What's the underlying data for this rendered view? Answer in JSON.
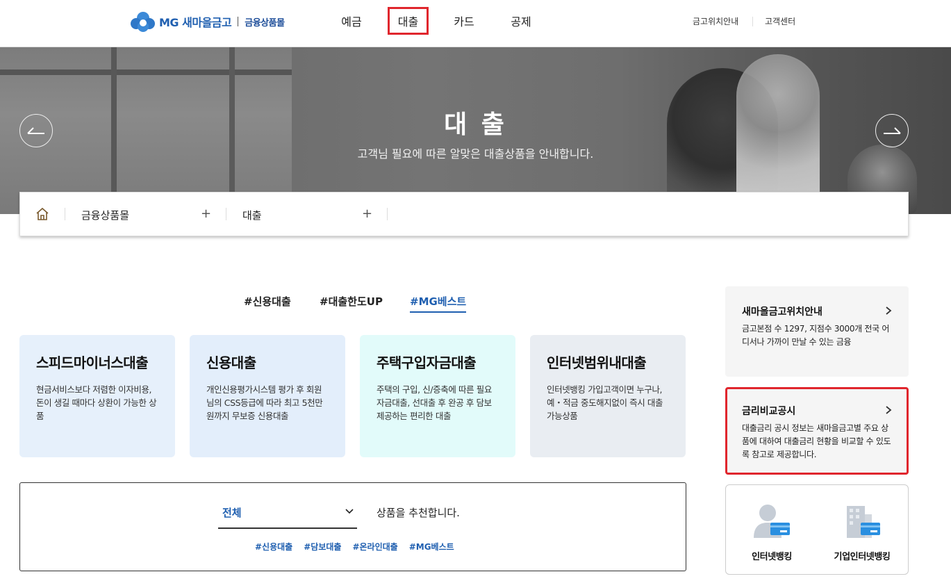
{
  "header": {
    "logo_brand": "MG 새마을금고",
    "logo_sub": "금융상품몰",
    "nav": [
      "예금",
      "대출",
      "카드",
      "공제"
    ],
    "util": [
      "금고위치안내",
      "고객센터"
    ]
  },
  "hero": {
    "title": "대 출",
    "subtitle": "고객님 필요에 따른 알맞은 대출상품을 안내합니다."
  },
  "breadcrumb": {
    "level1": "금융상품몰",
    "level2": "대출"
  },
  "hashtabs": [
    "#신용대출",
    "#대출한도UP",
    "#MG베스트"
  ],
  "cards": [
    {
      "title": "스피드마이너스대출",
      "desc": "현금서비스보다 저렴한 이자비용, 돈이 생길 때마다 상환이 가능한 상품",
      "color": "#e6f0fb"
    },
    {
      "title": "신용대출",
      "desc": "개인신용평가시스템 평가 후 회원님의 CSS등급에 따라 최고 5천만원까지 무보증 신용대출",
      "color": "#e3eefb"
    },
    {
      "title": "주택구입자금대출",
      "desc": "주택의 구입, 신/증축에 따른 필요자금대출, 선대출 후 완공 후 담보제공하는 편리한 대출",
      "color": "#e2fbfa"
    },
    {
      "title": "인터넷범위내대출",
      "desc": "인터넷뱅킹 가입고객이면 누구나, 예・적금 중도해지없이 즉시 대출가능상품",
      "color": "#e9edf2"
    }
  ],
  "recommend": {
    "select_value": "전체",
    "text": "상품을 추천합니다.",
    "tags": [
      "#신용대출",
      "#담보대출",
      "#온라인대출",
      "#MG베스트"
    ]
  },
  "side": {
    "location": {
      "title": "새마을금고위치안내",
      "desc": "금고본점 수 1297, 지점수 3000개 전국 어디서나 가까이 만날 수 있는 금융"
    },
    "rate": {
      "title": "금리비교공시",
      "desc": "대출금리 공시 정보는 새마을금고별 주요 상품에 대하여 대출금리 현황을 비교할 수 있도록 참고로 제공합니다."
    },
    "banking": [
      "인터넷뱅킹",
      "기업인터넷뱅킹"
    ]
  },
  "colors": {
    "brand_blue": "#1f5fb0",
    "highlight_red": "#e0262d"
  }
}
